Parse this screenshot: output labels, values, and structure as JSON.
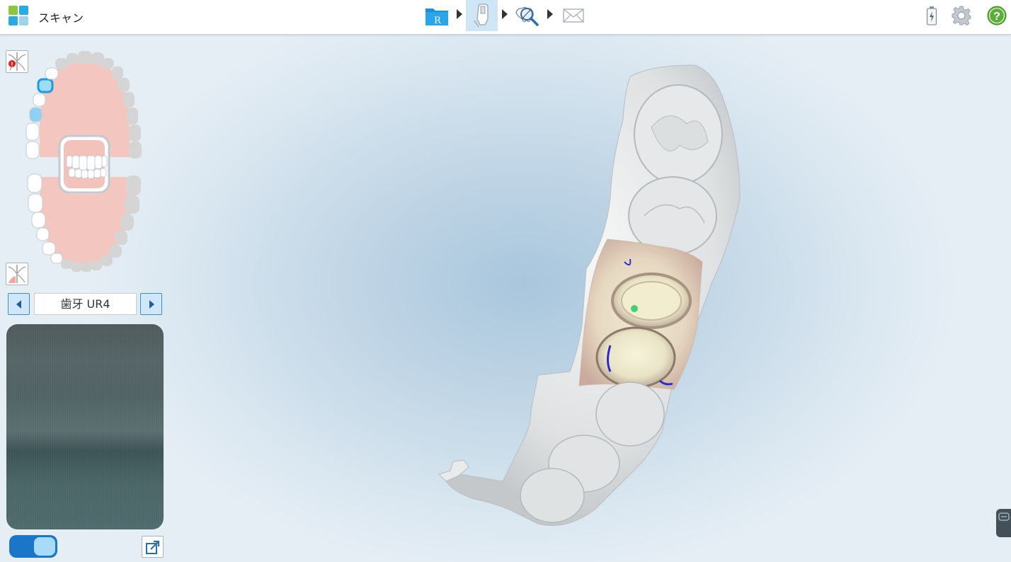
{
  "app": {
    "title": "スキャン",
    "logo_colors": [
      "#8cc63f",
      "#29abe2",
      "#29abe2",
      "#7fc4ea"
    ]
  },
  "workflow": {
    "steps": [
      {
        "name": "rx",
        "icon": "rx-folder-icon",
        "label": "R",
        "active": false
      },
      {
        "name": "scan",
        "icon": "scan-wand-icon",
        "active": true
      },
      {
        "name": "view",
        "icon": "view-magnifier-icon",
        "active": false
      },
      {
        "name": "send",
        "icon": "send-envelope-icon",
        "active": false
      }
    ],
    "active_color": "#cfe6f6"
  },
  "toolbar_right": {
    "battery_icon": "battery-charging-icon",
    "settings_icon": "gear-icon",
    "help_icon": "help-icon",
    "help_symbol": "?",
    "help_color": "#5cae3a"
  },
  "side_panel": {
    "upper_jaw_button_icon": "upper-jaw-warning-icon",
    "lower_jaw_button_icon": "lower-jaw-icon",
    "tooth_nav": {
      "label": "歯牙 UR4"
    },
    "camera_preview": "live-camera-feed",
    "toggle": {
      "state": "on",
      "color": "#1a76c8"
    },
    "popout_icon": "popout-window-icon"
  },
  "scan_model": {
    "tooth_highlight_color": "#e8c8b0",
    "margin_marker_color": "#2a2ad0",
    "point_marker_color": "#3fd07a"
  }
}
